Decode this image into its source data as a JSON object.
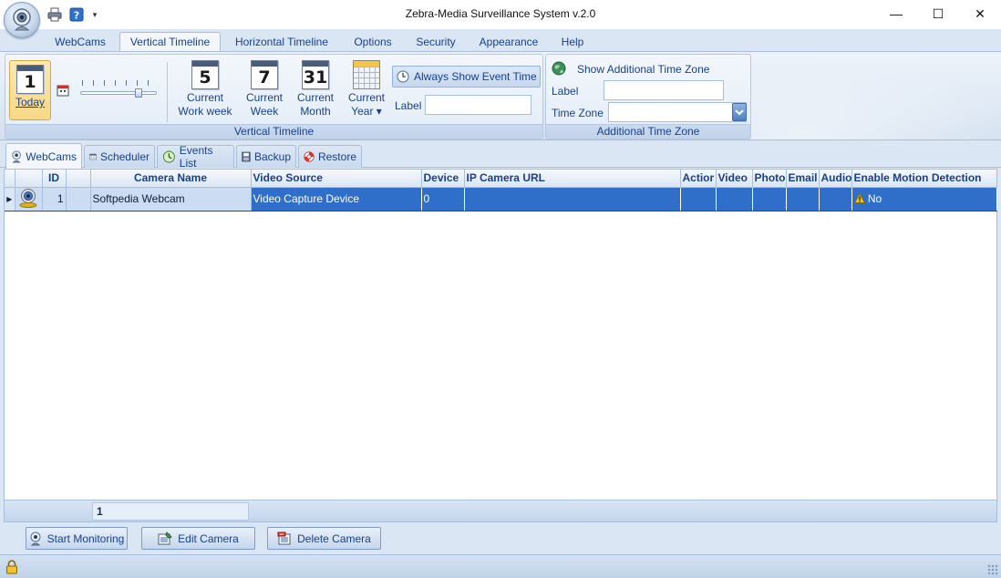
{
  "window": {
    "title": "Zebra-Media Surveillance System v.2.0",
    "minimize": "—",
    "maximize": "☐",
    "close": "✕"
  },
  "qat": {
    "dropdown": "▾"
  },
  "ribbon_tabs": [
    "WebCams",
    "Vertical Timeline",
    "Horizontal Timeline",
    "Options",
    "Security",
    "Appearance",
    "Help"
  ],
  "ribbon_active_tab": "Vertical Timeline",
  "vertical_timeline": {
    "group_label": "Vertical Timeline",
    "today": {
      "number": "1",
      "label": "Today"
    },
    "current_work_week": {
      "number": "5",
      "line1": "Current",
      "line2": "Work week"
    },
    "current_week": {
      "number": "7",
      "line1": "Current",
      "line2": "Week"
    },
    "current_month": {
      "number": "31",
      "line1": "Current",
      "line2": "Month"
    },
    "current_year": {
      "line1": "Current",
      "line2": "Year ▾"
    },
    "always_show_event_time": "Always Show Event Time",
    "label_caption": "Label",
    "label_value": ""
  },
  "additional_time_zone": {
    "group_label": "Additional Time Zone",
    "show_checkbox_label": "Show Additional Time Zone",
    "label_caption": "Label",
    "label_value": "",
    "time_zone_caption": "Time Zone",
    "time_zone_value": ""
  },
  "sub_tabs": [
    "WebCams",
    "Scheduler",
    "Events List",
    "Backup",
    "Restore"
  ],
  "grid": {
    "columns": [
      "",
      "",
      "ID",
      "",
      "Camera Name",
      "Video Source",
      "Device",
      "IP Camera URL",
      "Actior",
      "Video",
      "Photo",
      "Email",
      "Audio",
      "Enable Motion Detection"
    ],
    "rows": [
      {
        "indicator": "▸",
        "id": "1",
        "camera_name": "Softpedia Webcam",
        "video_source": "Video Capture Device",
        "device": "0",
        "ip_camera_url": "",
        "action": "",
        "video": "",
        "photo": "",
        "email": "",
        "audio": "",
        "motion_detection": "No"
      }
    ],
    "footer_count": "1"
  },
  "buttons": {
    "start_monitoring": "Start Monitoring",
    "edit_camera": "Edit Camera",
    "delete_camera": "Delete Camera"
  },
  "colors": {
    "accent": "#15428b",
    "selection": "#2f6fc9"
  }
}
